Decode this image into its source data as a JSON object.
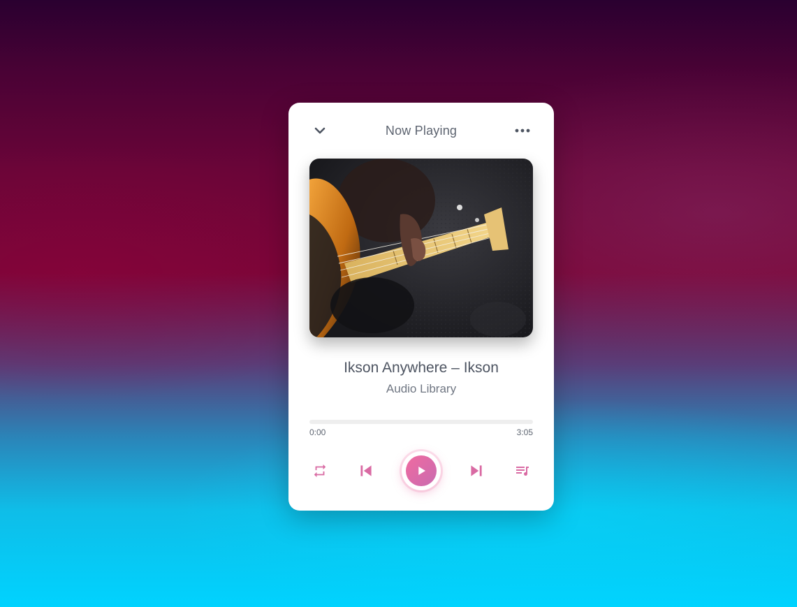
{
  "header": {
    "title": "Now Playing",
    "collapse_icon": "chevron-down-icon",
    "menu_icon": "more-horizontal-icon"
  },
  "track": {
    "title": "Ikson Anywhere – Ikson",
    "artist": "Audio Library",
    "cover_description": "bass guitar close-up"
  },
  "progress": {
    "current_time": "0:00",
    "duration": "3:05",
    "fraction": 0
  },
  "controls": {
    "repeat_icon": "repeat-icon",
    "previous_icon": "skip-previous-icon",
    "play_icon": "play-icon",
    "next_icon": "skip-next-icon",
    "playlist_icon": "playlist-music-icon"
  },
  "colors": {
    "accent": "#e56fa3",
    "accent_gradient_end": "#c96bb0",
    "text_primary": "#4d5461",
    "text_secondary": "#6f7682"
  }
}
